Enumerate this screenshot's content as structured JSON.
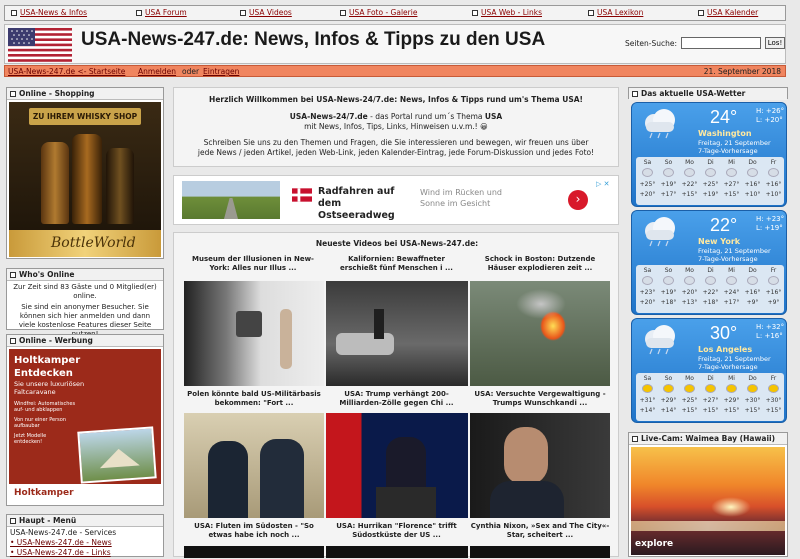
{
  "nav": [
    "USA-News & Infos",
    "USA Forum",
    "USA Videos",
    "USA Foto - Galerie",
    "USA Web - Links",
    "USA Lexikon",
    "USA Kalender"
  ],
  "header": {
    "title": "USA-News-247.de: News, Infos & Tipps zu den USA",
    "search_label": "Seiten-Suche:",
    "search_button": "Los!"
  },
  "subbar": {
    "home": "USA-News-247.de <- Startseite",
    "login": "Anmelden",
    "or": "oder",
    "register": "Eintragen",
    "date": "21. September 2018"
  },
  "left": {
    "shopping_title": "Online - Shopping",
    "shop_banner": "ZU IHREM WHISKY SHOP",
    "shop_brand": "BottleWorld",
    "whos_online_title": "Who's Online",
    "whos_online_text": "Zur Zeit sind 83 Gäste und 0 Mitglied(er) online.",
    "whos_online_text2": "Sie sind ein anonymer Besucher. Sie können sich hier anmelden und dann viele kostenlose Features dieser Seite nutzen!",
    "werbung_title": "Online - Werbung",
    "ad_brand": "Holtkamper",
    "ad_head": "Entdecken",
    "ad_sub": "Sie unsere luxuriösen Faltcaravane",
    "ad_lines": [
      "Windfrei: Automatisches auf- und abklappen",
      "Von nur einer Person aufbaubar",
      "Jetzt Modelle entdecken!"
    ],
    "ad_footer": "Holtkamper",
    "menu_title": "Haupt - Menü",
    "menu_items": [
      "USA-News-247.de - Services",
      "• USA-News-247.de - News",
      "• USA-News-247.de - Links"
    ]
  },
  "welcome": {
    "line1": "Herzlich Willkommen bei USA-News-24/7.de: News, Infos & Tipps rund um's Thema USA!",
    "line2a": "USA-News-24/7.de",
    "line2b": " - das Portal rund um´s Thema ",
    "line2c": "USA",
    "line3": "mit News, Infos, Tips, Links, Hinweisen u.v.m.! 😀",
    "line4": "Schreiben Sie uns zu den Themen und Fragen, die Sie interessieren und bewegen, wir freuen uns über",
    "line5": "jede News / jeden Artikel, jeden Web-Link, jeden Kalender-Eintrag, jede Forum-Diskussion und jedes Foto!"
  },
  "ad": {
    "title": "Radfahren auf dem Ostseeradweg",
    "text": "Wind im Rücken und Sonne im Gesicht"
  },
  "videos": {
    "title": "Neueste Videos bei USA-News-247.de:",
    "row1": [
      "Museum der Illusionen in New-York: Alles nur Illus ...",
      "Kalifornien: Bewaffneter erschießt fünf Menschen i ...",
      "Schock in Boston: Dutzende Häuser explodieren zeit ..."
    ],
    "row2": [
      "Polen könnte bald US-Militärbasis bekommen: \"Fort ...",
      "USA: Trump verhängt 200-Milliarden-Zölle gegen Chi ...",
      "USA: Versuchte Vergewaltigung - Trumps Wunschkandi ..."
    ],
    "row3": [
      "USA: Fluten im Südosten - \"So etwas habe ich noch ...",
      "USA: Hurrikan \"Florence\" trifft Südostküste der US ...",
      "Cynthia Nixon, »Sex and The City«-Star, scheitert ..."
    ]
  },
  "weather": {
    "title": "Das aktuelle USA-Wetter",
    "cities": [
      {
        "temp": "24°",
        "hi": "H: +26°",
        "lo": "L: +20°",
        "city": "Washington",
        "date": "Freitag, 21 September",
        "sub": "7-Tage-Vorhersage",
        "days": [
          "Sa",
          "So",
          "Mo",
          "Di",
          "Mi",
          "Do",
          "Fr"
        ],
        "his": [
          "+25°",
          "+19°",
          "+22°",
          "+25°",
          "+27°",
          "+16°",
          "+16°"
        ],
        "los": [
          "+20°",
          "+17°",
          "+15°",
          "+19°",
          "+15°",
          "+10°",
          "+10°"
        ]
      },
      {
        "temp": "22°",
        "hi": "H: +23°",
        "lo": "L: +19°",
        "city": "New York",
        "date": "Freitag, 21 September",
        "sub": "7-Tage-Vorhersage",
        "days": [
          "Sa",
          "So",
          "Mo",
          "Di",
          "Mi",
          "Do",
          "Fr"
        ],
        "his": [
          "+23°",
          "+19°",
          "+20°",
          "+22°",
          "+24°",
          "+16°",
          "+16°"
        ],
        "los": [
          "+20°",
          "+18°",
          "+13°",
          "+18°",
          "+17°",
          "+9°",
          "+9°"
        ]
      },
      {
        "temp": "30°",
        "hi": "H: +32°",
        "lo": "L: +16°",
        "city": "Los Angeles",
        "date": "Freitag, 21 September",
        "sub": "7-Tage-Vorhersage",
        "days": [
          "Sa",
          "So",
          "Mo",
          "Di",
          "Mi",
          "Do",
          "Fr"
        ],
        "his": [
          "+31°",
          "+29°",
          "+25°",
          "+27°",
          "+29°",
          "+30°",
          "+30°"
        ],
        "los": [
          "+14°",
          "+14°",
          "+15°",
          "+15°",
          "+15°",
          "+15°",
          "+15°"
        ]
      }
    ],
    "livecam_title": "Live-Cam: Waimea Bay (Hawaii)",
    "livecam_brand": "explore"
  }
}
